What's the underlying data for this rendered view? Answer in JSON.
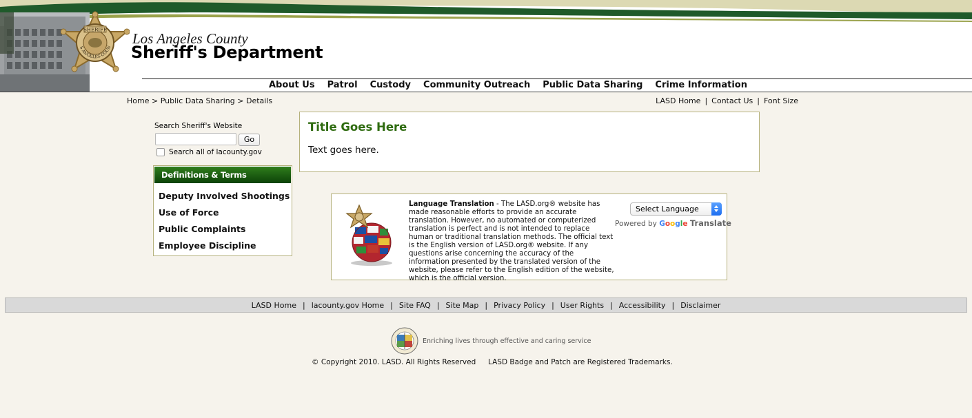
{
  "header": {
    "county_name": "Los Angeles County",
    "department_name": "Sheriff's Department",
    "badge_top_text": "SHERIFF",
    "badge_ring_text": "LOS ANGELES COUNTY",
    "nav": [
      "About Us",
      "Patrol",
      "Custody",
      "Community Outreach",
      "Public Data Sharing",
      "Crime Information"
    ]
  },
  "breadcrumb": {
    "home": "Home",
    "sep": " > ",
    "section": "Public Data Sharing",
    "current": "Details"
  },
  "utility_links": {
    "home": "LASD Home",
    "contact": "Contact Us",
    "font_size": "Font Size",
    "sep": "|"
  },
  "search": {
    "label": "Search Sheriff's Website",
    "value": "",
    "placeholder": "",
    "go_label": "Go",
    "search_all_label": "Search all of lacounty.gov",
    "search_all_checked": false
  },
  "definitions": {
    "header": "Definitions & Terms",
    "items": [
      "Deputy Involved Shootings",
      "Use of Force",
      "Public Complaints",
      "Employee Discipline"
    ]
  },
  "content": {
    "title": "Title Goes Here",
    "text": "Text goes here."
  },
  "translation": {
    "heading": "Language Translation",
    "dash": " - ",
    "body": "The LASD.org® website has made reasonable efforts to provide an accurate translation. However, no automated or computerized translation is perfect and is not intended to replace human or traditional translation methods. The official text is the English version of LASD.org® website. If any questions arise concerning the accuracy of the information presented by the translated version of the website, please refer to the English edition of the website, which is the official version.",
    "select_label": "Select Language",
    "powered_by": "Powered by",
    "google": "Google",
    "translate": "Translate"
  },
  "footer": {
    "links": [
      "LASD Home",
      "lacounty.gov Home",
      "Site FAQ",
      "Site Map",
      "Privacy Policy",
      "User Rights",
      "Accessibility",
      "Disclaimer"
    ],
    "tagline": "Enriching lives through effective and caring service",
    "copyright": "© Copyright 2010. LASD. All Rights Reserved",
    "trademarks": "LASD Badge and Patch are Registered Trademarks."
  },
  "colors": {
    "page_bg": "#f6f3ec",
    "header_green": "#1f5a2a",
    "header_tan": "#dcd9b3",
    "title_green": "#2e6b0f",
    "box_border": "#b5b17c"
  }
}
